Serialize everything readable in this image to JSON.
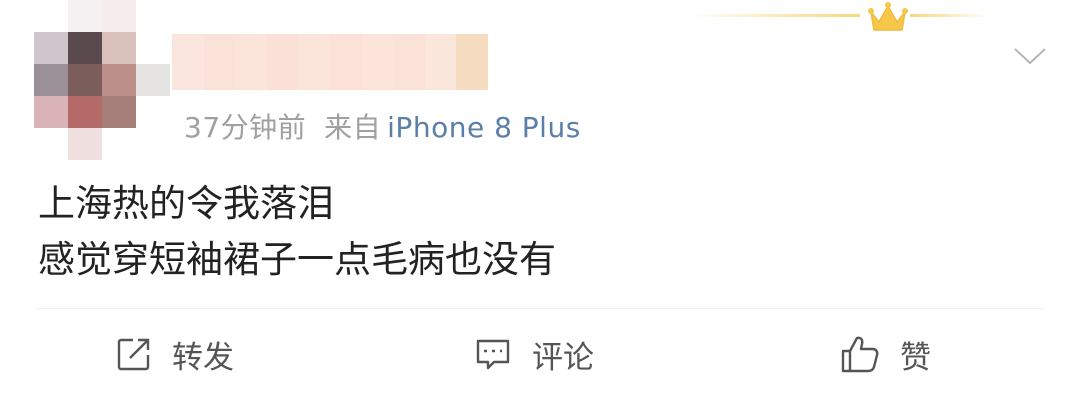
{
  "post": {
    "time_ago": "37分钟前",
    "source_prefix": "来自",
    "source_device": "iPhone 8 Plus",
    "lines": [
      "上海热的令我落泪",
      "感觉穿短袖裙子一点毛病也没有"
    ]
  },
  "actions": {
    "repost_label": "转发",
    "comment_label": "评论",
    "like_label": "赞"
  },
  "colors": {
    "meta_gray": "#a0a0a0",
    "device_blue": "#5b7fa8",
    "text": "#222222",
    "action_text": "#555555",
    "crown_gold": "#f6c84a"
  },
  "icons": {
    "crown": "crown-icon",
    "chevron": "chevron-down-icon",
    "repost": "repost-icon",
    "comment": "comment-icon",
    "like": "thumbs-up-icon"
  }
}
